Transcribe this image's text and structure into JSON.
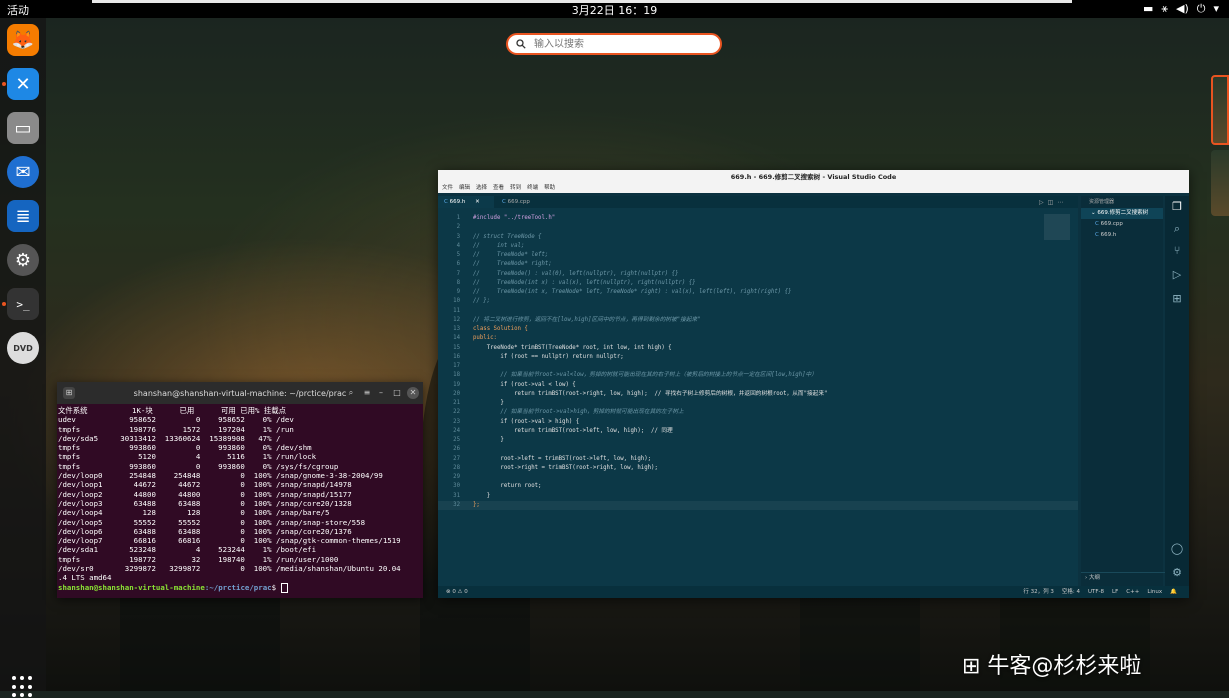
{
  "topbar": {
    "activities": "活动",
    "clock": "3月22日  16：19",
    "tray": [
      "▬",
      "⚹",
      "◀)",
      "⏻",
      "▾"
    ]
  },
  "search": {
    "placeholder": "输入以搜索"
  },
  "dock": {
    "items": [
      {
        "name": "firefox",
        "glyph": "🦊",
        "color": "#e66000"
      },
      {
        "name": "vscode",
        "glyph": "✕",
        "color": "#1e88e5"
      },
      {
        "name": "files",
        "glyph": "▭",
        "color": "#7b7b7b"
      },
      {
        "name": "thunderbird",
        "glyph": "✉",
        "color": "#1f6fd1"
      },
      {
        "name": "writer",
        "glyph": "≣",
        "color": "#1565c0"
      },
      {
        "name": "settings",
        "glyph": "⚙",
        "color": "#555"
      },
      {
        "name": "terminal",
        "glyph": ">_",
        "color": "#333"
      },
      {
        "name": "dvd",
        "glyph": "DVD",
        "color": "#ccc"
      }
    ]
  },
  "terminal": {
    "title": "shanshan@shanshan-virtual-machine: ~/prctice/prac",
    "lines": [
      "文件系统          1K-块      已用      可用 已用% 挂载点",
      "udev            958652         0    958652    0% /dev",
      "tmpfs           198776      1572    197204    1% /run",
      "/dev/sda5     30313412  13360624  15389908   47% /",
      "tmpfs           993860         0    993860    0% /dev/shm",
      "tmpfs             5120         4      5116    1% /run/lock",
      "tmpfs           993860         0    993860    0% /sys/fs/cgroup",
      "/dev/loop0      254848    254848         0  100% /snap/gnome-3-38-2004/99",
      "/dev/loop1       44672     44672         0  100% /snap/snapd/14978",
      "/dev/loop2       44800     44800         0  100% /snap/snapd/15177",
      "/dev/loop3       63488     63488         0  100% /snap/core20/1328",
      "/dev/loop4         128       128         0  100% /snap/bare/5",
      "/dev/loop5       55552     55552         0  100% /snap/snap-store/558",
      "/dev/loop6       63488     63488         0  100% /snap/core20/1376",
      "/dev/loop7       66816     66816         0  100% /snap/gtk-common-themes/1519",
      "/dev/sda1       523248         4    523244    1% /boot/efi",
      "tmpfs           198772        32    198740    1% /run/user/1000",
      "/dev/sr0       3299872   3299872         0  100% /media/shanshan/Ubuntu 20.04",
      ".4 LTS amd64"
    ],
    "prompt_user": "shanshan@shanshan-virtual-machine",
    "prompt_path": ":~/prctice/prac",
    "prompt_sym": "$ "
  },
  "vscode": {
    "title": "669.h - 669.修剪二叉搜索树 - Visual Studio Code",
    "menu": [
      "文件",
      "编辑",
      "选择",
      "查看",
      "转到",
      "终端",
      "帮助"
    ],
    "tabs": [
      "669.h",
      "669.cpp"
    ],
    "explorer_header": "资源管理器",
    "folder": "669.修剪二叉搜索树",
    "files": [
      "669.cpp",
      "669.h"
    ],
    "outline": "大纲",
    "status_left": "⊗ 0 ⚠ 0",
    "status_right": [
      "行 32，列 3",
      "空格: 4",
      "UTF-8",
      "LF",
      "C++",
      "Linux"
    ],
    "code": [
      {
        "t": "#include \"../treeTool.h\"",
        "k": "pre"
      },
      {
        "t": "",
        "k": ""
      },
      {
        "t": "// struct TreeNode {",
        "k": "comment"
      },
      {
        "t": "//     int val;",
        "k": "comment"
      },
      {
        "t": "//     TreeNode* left;",
        "k": "comment"
      },
      {
        "t": "//     TreeNode* right;",
        "k": "comment"
      },
      {
        "t": "//     TreeNode() : val(0), left(nullptr), right(nullptr) {}",
        "k": "comment"
      },
      {
        "t": "//     TreeNode(int x) : val(x), left(nullptr), right(nullptr) {}",
        "k": "comment"
      },
      {
        "t": "//     TreeNode(int x, TreeNode* left, TreeNode* right) : val(x), left(left), right(right) {}",
        "k": "comment"
      },
      {
        "t": "// };",
        "k": "comment"
      },
      {
        "t": "",
        "k": ""
      },
      {
        "t": "// 将二叉树进行修剪，返回不在[low,high]区间中的节点，再得到剩余的树被\"接起来\"",
        "k": "comment"
      },
      {
        "t": "class Solution {",
        "k": "keyword"
      },
      {
        "t": "public:",
        "k": "keyword"
      },
      {
        "t": "    TreeNode* trimBST(TreeNode* root, int low, int high) {",
        "k": ""
      },
      {
        "t": "        if (root == nullptr) return nullptr;",
        "k": ""
      },
      {
        "t": "",
        "k": ""
      },
      {
        "t": "        // 如果当前节root->val<low，剪掉的树就可能出现在其的右子树上（被剪后的树接上的节点一定在区间[low,high]中）",
        "k": "comment"
      },
      {
        "t": "        if (root->val < low) {",
        "k": ""
      },
      {
        "t": "            return trimBST(root->right, low, high);  // 寻找右子树上修剪后的树根，并返回的树根root，从而\"接起来\"",
        "k": ""
      },
      {
        "t": "        }",
        "k": ""
      },
      {
        "t": "        // 如果当前节root->val>high，剪掉的树就可能出现在其的左子树上",
        "k": "comment"
      },
      {
        "t": "        if (root->val > high) {",
        "k": ""
      },
      {
        "t": "            return trimBST(root->left, low, high);  // 同理",
        "k": ""
      },
      {
        "t": "        }",
        "k": ""
      },
      {
        "t": "",
        "k": ""
      },
      {
        "t": "        root->left = trimBST(root->left, low, high);",
        "k": ""
      },
      {
        "t": "        root->right = trimBST(root->right, low, high);",
        "k": ""
      },
      {
        "t": "",
        "k": ""
      },
      {
        "t": "        return root;",
        "k": ""
      },
      {
        "t": "    }",
        "k": ""
      },
      {
        "t": "};",
        "k": "keyword"
      }
    ]
  },
  "watermark": "⊞ 牛客@杉杉来啦"
}
